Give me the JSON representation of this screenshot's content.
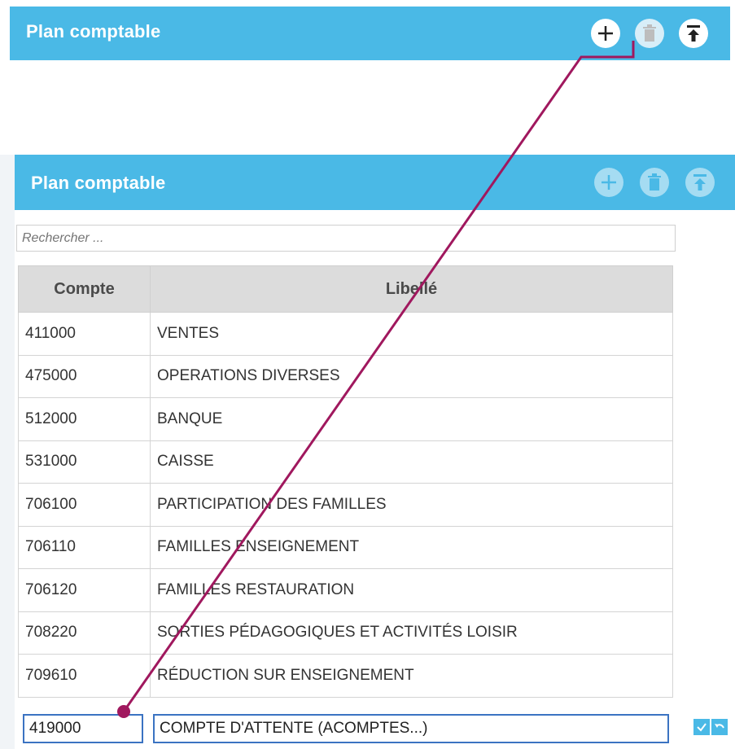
{
  "top_panel": {
    "title": "Plan comptable",
    "buttons": [
      {
        "icon": "plus-icon",
        "state": "enabled"
      },
      {
        "icon": "trash-icon",
        "state": "disabled"
      },
      {
        "icon": "export-top-icon",
        "state": "enabled"
      }
    ]
  },
  "panel": {
    "title": "Plan comptable",
    "search_placeholder": "Rechercher ...",
    "columns": [
      "Compte",
      "Libellé"
    ],
    "rows": [
      {
        "compte": "411000",
        "libelle": "VENTES"
      },
      {
        "compte": "475000",
        "libelle": "OPERATIONS DIVERSES"
      },
      {
        "compte": "512000",
        "libelle": "BANQUE"
      },
      {
        "compte": "531000",
        "libelle": "CAISSE"
      },
      {
        "compte": "706100",
        "libelle": "PARTICIPATION DES FAMILLES"
      },
      {
        "compte": "706110",
        "libelle": "FAMILLES ENSEIGNEMENT"
      },
      {
        "compte": "706120",
        "libelle": "FAMILLES RESTAURATION"
      },
      {
        "compte": "708220",
        "libelle": "SORTIES PÉDAGOGIQUES ET ACTIVITÉS LOISIR"
      },
      {
        "compte": "709610",
        "libelle": "RÉDUCTION SUR ENSEIGNEMENT"
      }
    ],
    "edit_row": {
      "compte": "419000",
      "libelle": "COMPTE D'ATTENTE (ACOMPTES...)"
    }
  },
  "colors": {
    "header_blue": "#4ab9e6",
    "annotation": "#a0185e",
    "input_border": "#3b73c2"
  }
}
